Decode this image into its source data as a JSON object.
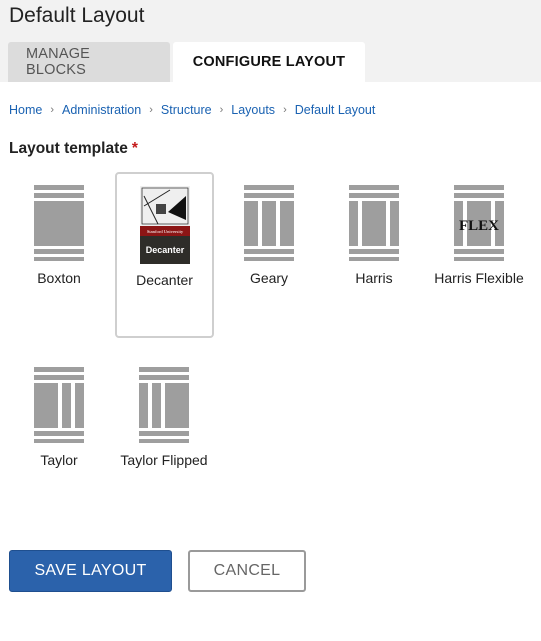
{
  "page": {
    "title": "Default Layout"
  },
  "tabs": [
    {
      "label": "MANAGE BLOCKS",
      "active": false
    },
    {
      "label": "CONFIGURE LAYOUT",
      "active": true
    }
  ],
  "breadcrumb": [
    "Home",
    "Administration",
    "Structure",
    "Layouts",
    "Default Layout"
  ],
  "form": {
    "layout_template_label": "Layout template",
    "required_marker": "*",
    "options": [
      {
        "name": "Boxton",
        "icon": "boxton-layout-icon",
        "selected": false
      },
      {
        "name": "Decanter",
        "icon": "decanter-layout-icon",
        "selected": true,
        "thumb_text_top": "Stanford University",
        "thumb_text_bottom": "Decanter"
      },
      {
        "name": "Geary",
        "icon": "geary-layout-icon",
        "selected": false
      },
      {
        "name": "Harris",
        "icon": "harris-layout-icon",
        "selected": false
      },
      {
        "name": "Harris Flexible",
        "icon": "harris-flexible-layout-icon",
        "selected": false,
        "thumb_text": "FLEX"
      },
      {
        "name": "Taylor",
        "icon": "taylor-layout-icon",
        "selected": false
      },
      {
        "name": "Taylor Flipped",
        "icon": "taylor-flipped-layout-icon",
        "selected": false
      }
    ]
  },
  "actions": {
    "save": "SAVE LAYOUT",
    "cancel": "CANCEL"
  },
  "colors": {
    "primary": "#2b62ab",
    "link": "#1a62b2",
    "required": "#c41a1a",
    "thumb_gray": "#9e9e9e"
  }
}
